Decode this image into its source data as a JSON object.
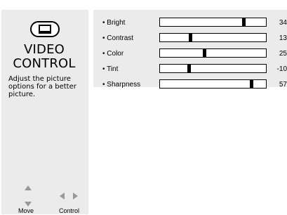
{
  "panel": {
    "title": "VIDEO\nCONTROL",
    "description": "Adjust the picture options for a better picture.",
    "icon": "tv-icon"
  },
  "nav": {
    "move_label": "Move",
    "control_label": "Control",
    "arrow_color": "#999999"
  },
  "settings": [
    {
      "label": "• Bright",
      "value": "34",
      "fraction": 0.8
    },
    {
      "label": "• Contrast",
      "value": "13",
      "fraction": 0.28
    },
    {
      "label": "• Color",
      "value": "25",
      "fraction": 0.42
    },
    {
      "label": "• Tint",
      "value": "-10",
      "fraction": 0.27
    },
    {
      "label": "• Sharpness",
      "value": "57",
      "fraction": 0.88
    }
  ],
  "colors": {
    "panel_bg": "#ebebeb",
    "track_bg": "#ffffff",
    "thumb": "#000000"
  }
}
